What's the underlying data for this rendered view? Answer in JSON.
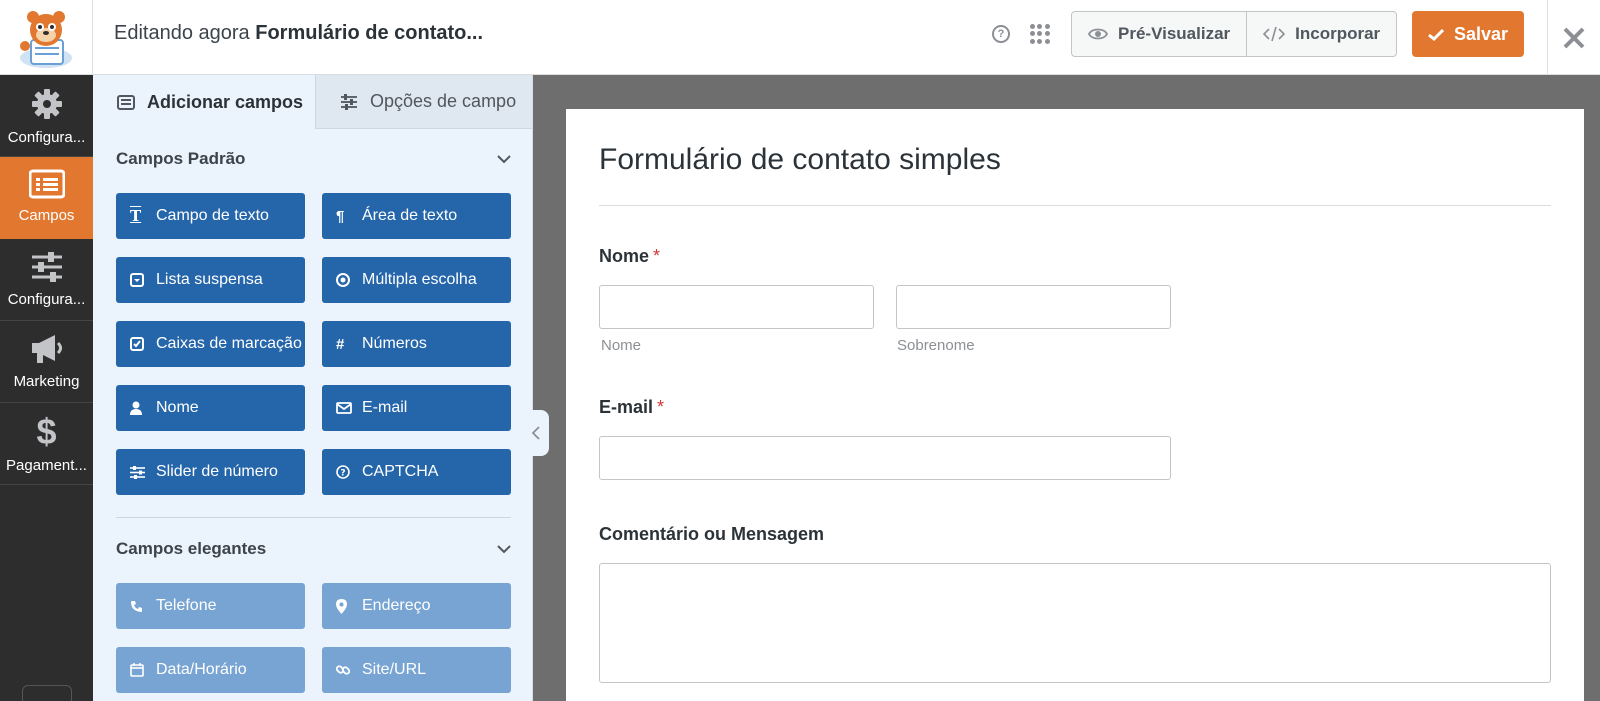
{
  "header": {
    "editing_prefix": "Editando agora",
    "form_name": "Formulário de contato...",
    "preview_label": "Pré-Visualizar",
    "embed_label": "Incorporar",
    "save_label": "Salvar"
  },
  "nav": [
    {
      "label": "Configura...",
      "icon": "gear-icon"
    },
    {
      "label": "Campos",
      "icon": "fields-list-icon",
      "active": true
    },
    {
      "label": "Configura...",
      "icon": "sliders-icon"
    },
    {
      "label": "Marketing",
      "icon": "megaphone-icon"
    },
    {
      "label": "Pagament...",
      "icon": "dollar-icon"
    }
  ],
  "panel": {
    "tab_add": "Adicionar campos",
    "tab_options": "Opções de campo",
    "standard_title": "Campos Padrão",
    "standard": [
      {
        "label": "Campo de texto",
        "icon": "T"
      },
      {
        "label": "Área de texto",
        "icon": "¶"
      },
      {
        "label": "Lista suspensa",
        "icon": "▾"
      },
      {
        "label": "Múltipla escolha",
        "icon": "◉"
      },
      {
        "label": "Caixas de marcação",
        "icon": "☑"
      },
      {
        "label": "Números",
        "icon": "#"
      },
      {
        "label": "Nome",
        "icon": "person"
      },
      {
        "label": "E-mail",
        "icon": "✉"
      },
      {
        "label": "Slider de número",
        "icon": "sliders"
      },
      {
        "label": "CAPTCHA",
        "icon": "?"
      }
    ],
    "fancy_title": "Campos elegantes",
    "fancy": [
      {
        "label": "Telefone",
        "icon": "phone"
      },
      {
        "label": "Endereço",
        "icon": "pin"
      },
      {
        "label": "Data/Horário",
        "icon": "calendar"
      },
      {
        "label": "Site/URL",
        "icon": "link"
      }
    ]
  },
  "form": {
    "title": "Formulário de contato simples",
    "name_label": "Nome",
    "first_sublabel": "Nome",
    "last_sublabel": "Sobrenome",
    "email_label": "E-mail",
    "required_mark": "*",
    "message_label": "Comentário ou Mensagem"
  },
  "colors": {
    "accent": "#e27730",
    "field_button": "#2566ab",
    "field_button_light": "#77a4d2",
    "sidebar": "#2d2d2d"
  }
}
